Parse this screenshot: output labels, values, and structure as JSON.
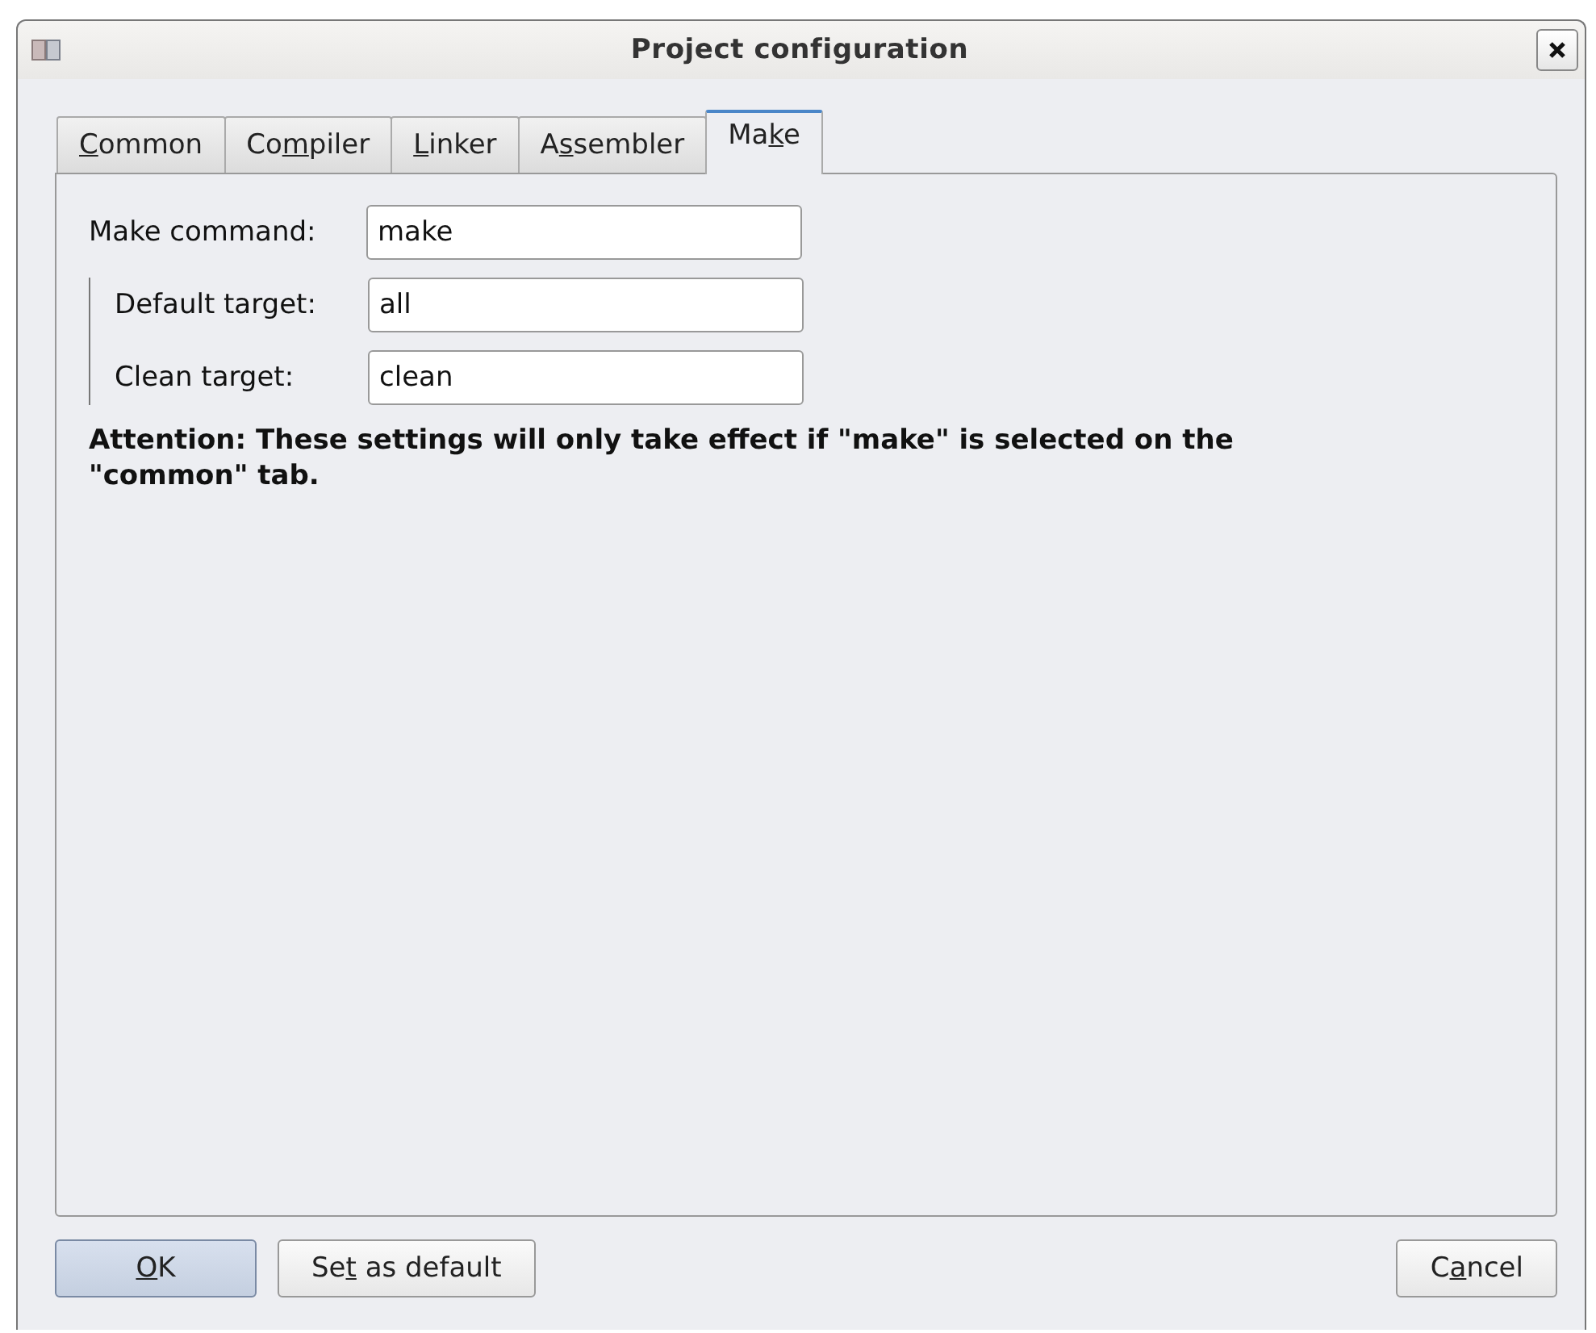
{
  "window": {
    "title": "Project configuration"
  },
  "tabs": [
    {
      "key": "C",
      "post": "ommon",
      "selected": false
    },
    {
      "pre": "Co",
      "key": "m",
      "post": "piler",
      "selected": false
    },
    {
      "key": "L",
      "post": "inker",
      "selected": false
    },
    {
      "pre": "A",
      "key": "s",
      "post": "sembler",
      "selected": false
    },
    {
      "pre": "Ma",
      "key": "k",
      "post": "e",
      "selected": true
    }
  ],
  "make_command": {
    "label": "Make command:",
    "value": "make"
  },
  "targets": [
    {
      "label": "Default target:",
      "value": "all"
    },
    {
      "label": "Clean target:",
      "value": "clean"
    }
  ],
  "attention": "Attention: These settings will only take effect if \"make\" is selected on the \"common\" tab.",
  "buttons_left": [
    {
      "key": "O",
      "post": "K",
      "default": true
    },
    {
      "pre": "Se",
      "key": "t",
      "post": " as default",
      "default": false
    }
  ],
  "buttons_right": [
    {
      "pre": "C",
      "key": "a",
      "post": "ncel",
      "default": false
    }
  ]
}
